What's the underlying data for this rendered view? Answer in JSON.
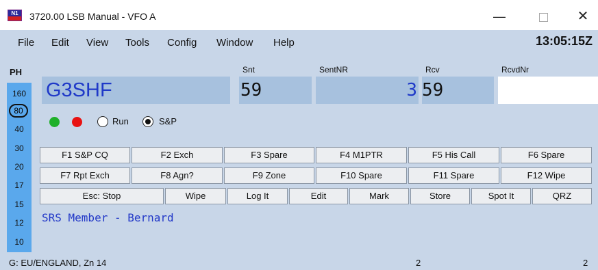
{
  "window": {
    "title": "3720.00 LSB Manual - VFO A",
    "icon_text": "N1",
    "controls": {
      "minimize": "—",
      "close": "✕"
    }
  },
  "menu": {
    "items": [
      "File",
      "Edit",
      "View",
      "Tools",
      "Config",
      "Window",
      "Help"
    ],
    "clock": "13:05:15Z"
  },
  "bands": {
    "mode_label": "PH",
    "items": [
      "160",
      "80",
      "40",
      "30",
      "20",
      "17",
      "15",
      "12",
      "10"
    ],
    "selected": "80"
  },
  "entry": {
    "labels": {
      "snt": "Snt",
      "sentnr": "SentNR",
      "rcv": "Rcv",
      "rcvdnr": "RcvdNr"
    },
    "callsign": "G3SHF",
    "snt": "59",
    "sentnr": "3",
    "rcv": "59",
    "rcvdnr": ""
  },
  "mode_select": {
    "options": [
      "Run",
      "S&P"
    ],
    "selected": "S&P"
  },
  "function_keys": {
    "row1": [
      "F1 S&P CQ",
      "F2 Exch",
      "F3 Spare",
      "F4 M1PTR",
      "F5 His Call",
      "F6 Spare"
    ],
    "row2": [
      "F7 Rpt Exch",
      "F8 Agn?",
      "F9 Zone",
      "F10 Spare",
      "F11 Spare",
      "F12 Wipe"
    ]
  },
  "actions": {
    "esc_stop": "Esc: Stop",
    "wipe": "Wipe",
    "log_it": "Log It",
    "edit": "Edit",
    "mark": "Mark",
    "store": "Store",
    "spot_it": "Spot It",
    "qrz": "QRZ"
  },
  "info_line": "SRS Member - Bernard",
  "status": {
    "left": "G: EU/ENGLAND, Zn 14",
    "middle": "2",
    "right": "2"
  },
  "colors": {
    "window_bg": "#c8d6e8",
    "field_bg": "#a7c1de",
    "band_panel": "#5aa8ec",
    "callsign_text": "#1f39c8",
    "led_green": "#1fb02a",
    "led_red": "#e81212"
  }
}
